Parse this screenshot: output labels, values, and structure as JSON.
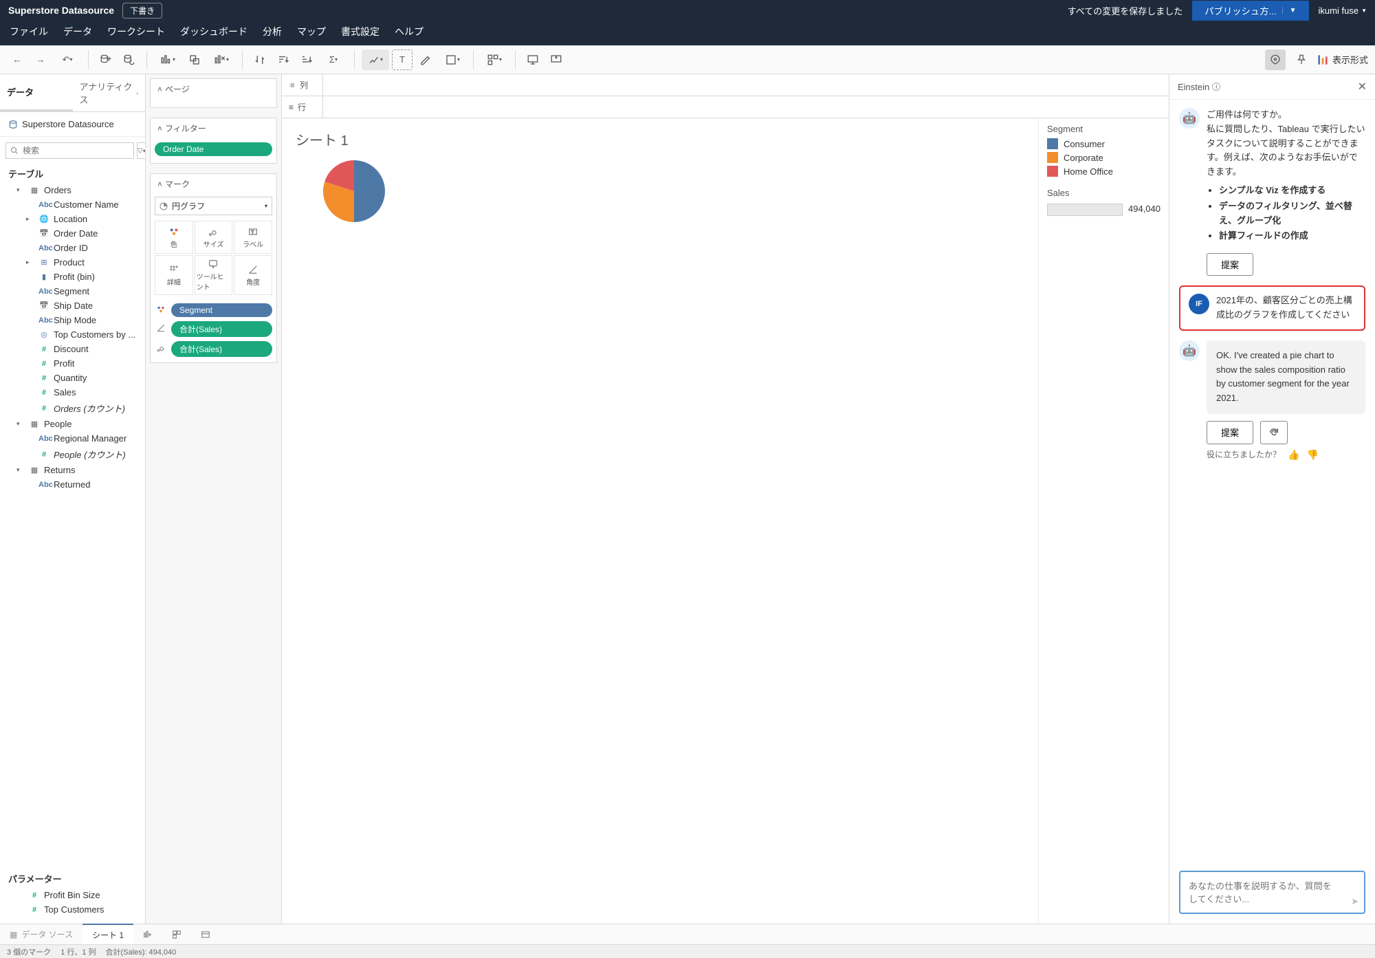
{
  "header": {
    "title": "Superstore Datasource",
    "draft": "下書き",
    "save_status": "すべての変更を保存しました",
    "publish": "パブリッシュ方...",
    "user": "ikumi fuse"
  },
  "menu": [
    "ファイル",
    "データ",
    "ワークシート",
    "ダッシュボード",
    "分析",
    "マップ",
    "書式設定",
    "ヘルプ"
  ],
  "showme": "表示形式",
  "data_panel": {
    "tabs": {
      "data": "データ",
      "analytics": "アナリティクス"
    },
    "source": "Superstore Datasource",
    "search_ph": "検索",
    "tables_hdr": "テーブル",
    "params_hdr": "パラメーター"
  },
  "tables": {
    "orders": {
      "name": "Orders",
      "fields": [
        {
          "name": "Customer Name",
          "ico": "abc",
          "color": "blue"
        },
        {
          "name": "Location",
          "ico": "globe",
          "color": "blue",
          "exp": true
        },
        {
          "name": "Order Date",
          "ico": "date",
          "color": "blue"
        },
        {
          "name": "Order ID",
          "ico": "abc",
          "color": "blue"
        },
        {
          "name": "Product",
          "ico": "hier",
          "color": "blue",
          "exp": true
        },
        {
          "name": "Profit (bin)",
          "ico": "bars",
          "color": "blue"
        },
        {
          "name": "Segment",
          "ico": "abc",
          "color": "blue"
        },
        {
          "name": "Ship Date",
          "ico": "date",
          "color": "blue"
        },
        {
          "name": "Ship Mode",
          "ico": "abc",
          "color": "blue"
        },
        {
          "name": "Top Customers by ...",
          "ico": "set",
          "color": "blue"
        },
        {
          "name": "Discount",
          "ico": "hash",
          "color": "teal"
        },
        {
          "name": "Profit",
          "ico": "hash",
          "color": "teal"
        },
        {
          "name": "Quantity",
          "ico": "hash",
          "color": "teal"
        },
        {
          "name": "Sales",
          "ico": "hash",
          "color": "teal"
        },
        {
          "name": "Orders (カウント)",
          "ico": "hash",
          "color": "teal",
          "italic": true
        }
      ]
    },
    "people": {
      "name": "People",
      "fields": [
        {
          "name": "Regional Manager",
          "ico": "abc",
          "color": "blue"
        },
        {
          "name": "People (カウント)",
          "ico": "hash",
          "color": "teal",
          "italic": true
        }
      ]
    },
    "returns": {
      "name": "Returns",
      "fields": [
        {
          "name": "Returned",
          "ico": "abc",
          "color": "blue"
        }
      ]
    }
  },
  "params": [
    {
      "name": "Profit Bin Size",
      "ico": "hash",
      "color": "teal"
    },
    {
      "name": "Top Customers",
      "ico": "hash",
      "color": "teal"
    }
  ],
  "shelves": {
    "pages": "ページ",
    "filters": "フィルター",
    "filter_pill": "Order Date",
    "marks": "マーク",
    "mark_type": "円グラフ",
    "btns": {
      "color": "色",
      "size": "サイズ",
      "label": "ラベル",
      "detail": "詳細",
      "tooltip": "ツールヒント",
      "angle": "角度"
    },
    "pills": [
      {
        "label": "Segment",
        "cls": "blue"
      },
      {
        "label": "合計(Sales)",
        "cls": "green"
      },
      {
        "label": "合計(Sales)",
        "cls": "green"
      }
    ]
  },
  "viz": {
    "cols": "列",
    "rows": "行",
    "sheet_title": "シート 1",
    "legend_hdr": "Segment",
    "legend": [
      {
        "label": "Consumer",
        "color": "#4e79a7"
      },
      {
        "label": "Corporate",
        "color": "#f28e2c"
      },
      {
        "label": "Home Office",
        "color": "#e15759"
      }
    ],
    "sales_hdr": "Sales",
    "sales_val": "494,040"
  },
  "chart_data": {
    "type": "pie",
    "title": "シート 1",
    "series_name": "Segment",
    "value_name": "Sales",
    "total": 494040,
    "slices": [
      {
        "label": "Consumer",
        "pct": 50,
        "color": "#4e79a7"
      },
      {
        "label": "Corporate",
        "pct": 30,
        "color": "#f28e2c"
      },
      {
        "label": "Home Office",
        "pct": 20,
        "color": "#e15759"
      }
    ]
  },
  "einstein": {
    "title": "Einstein",
    "greeting": "ご用件は何ですか。",
    "intro": "私に質問したり、Tableau で実行したいタスクについて説明することができます。例えば、次のようなお手伝いができます。",
    "bullets": [
      "シンプルな Viz を作成する",
      "データのフィルタリング、並べ替え、グループ化",
      "計算フィールドの作成"
    ],
    "suggest": "提案",
    "user_initials": "IF",
    "user_msg": "2021年の、顧客区分ごとの売上構成比のグラフを作成してください",
    "reply": "OK. I've created a pie chart to show the sales composition ratio by customer segment for the year 2021.",
    "feedback": "役に立ちましたか？",
    "input_ph": "あなたの仕事を説明するか、質問をしてください..."
  },
  "bottom": {
    "datasource": "データ ソース",
    "sheet": "シート 1"
  },
  "status": {
    "marks": "3 個のマーク",
    "dims": "1 行、1 列",
    "sum": "合計(Sales): 494,040"
  }
}
